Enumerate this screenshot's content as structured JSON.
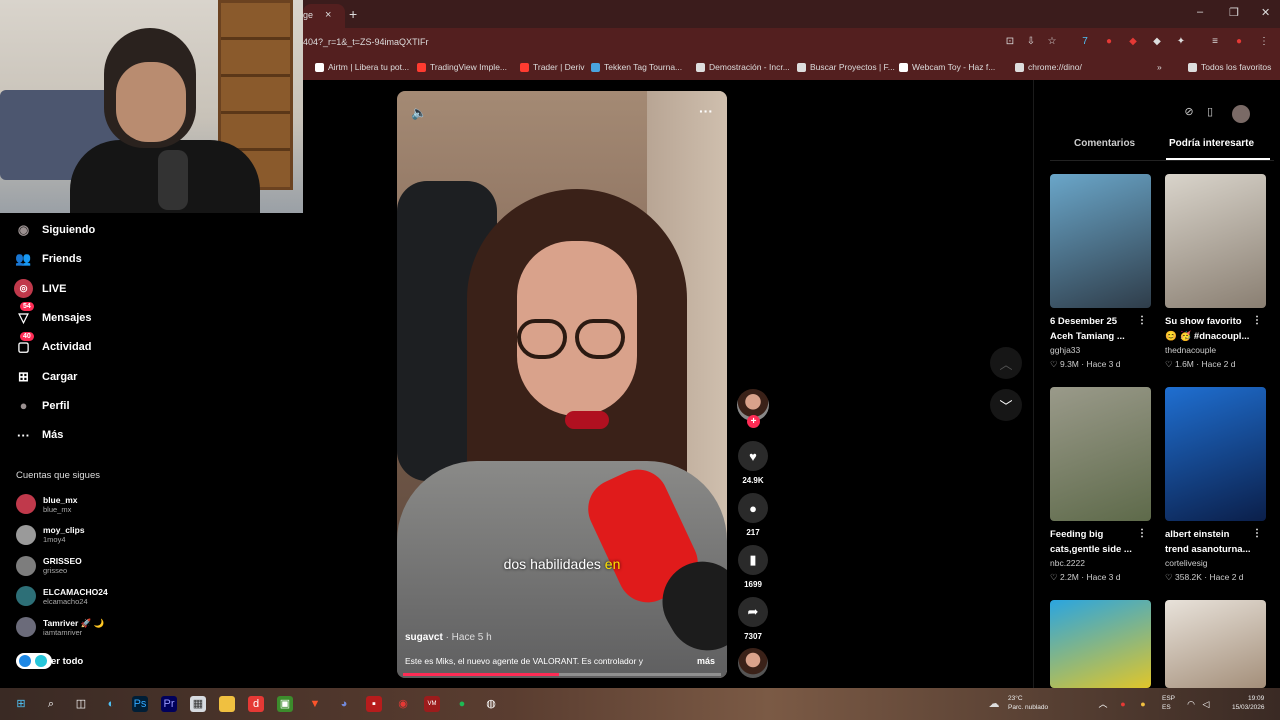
{
  "browser": {
    "tab_close": "×",
    "tab_partial_title": "ge",
    "new_tab": "+",
    "url": "404?_r=1&_t=ZS-94imaQXTIFr",
    "window_controls": {
      "minimize": "–",
      "restore": "❐",
      "close": "✕"
    },
    "bookmarks": [
      {
        "label": "Airtm | Libera tu pot...",
        "color": "#ffffff"
      },
      {
        "label": "TradingView Imple...",
        "color": "#ff3b30"
      },
      {
        "label": "Trader | Deriv",
        "color": "#ff3b30"
      },
      {
        "label": "Tekken Tag Tourna...",
        "color": "#4aa3df"
      },
      {
        "label": "Demostración - Incr...",
        "color": "#dddddd"
      },
      {
        "label": "Buscar Proyectos | F...",
        "color": "#dddddd"
      },
      {
        "label": "Webcam Toy - Haz f...",
        "color": "#ffffff"
      },
      {
        "label": "chrome://dino/",
        "color": "#dddddd"
      }
    ],
    "bookmarks_overflow": "»",
    "all_bookmarks": "Todos los favoritos"
  },
  "sidebar": {
    "nav": [
      {
        "label": "Siguiendo",
        "icon": "following-avatar-icon",
        "glyph": "◉",
        "badge": ""
      },
      {
        "label": "Friends",
        "icon": "friends-icon",
        "glyph": "👥",
        "badge": ""
      },
      {
        "label": "LIVE",
        "icon": "live-icon",
        "glyph": "◎",
        "badge": ""
      },
      {
        "label": "Mensajes",
        "icon": "messages-icon",
        "glyph": "▽",
        "badge": "54"
      },
      {
        "label": "Actividad",
        "icon": "activity-icon",
        "glyph": "▢",
        "badge": "40"
      },
      {
        "label": "Cargar",
        "icon": "upload-icon",
        "glyph": "⊞",
        "badge": ""
      },
      {
        "label": "Perfil",
        "icon": "profile-avatar-icon",
        "glyph": "●",
        "badge": ""
      },
      {
        "label": "Más",
        "icon": "more-icon",
        "glyph": "···",
        "badge": ""
      }
    ],
    "following_title": "Cuentas que sigues",
    "following": [
      {
        "name": "blue_mx",
        "handle": "blue_mx",
        "color": "#c0394b"
      },
      {
        "name": "moy_clips",
        "handle": "1moy4",
        "color": "#9a9a9a"
      },
      {
        "name": "GRISSEO",
        "handle": "grisseo",
        "color": "#7d7d7d"
      },
      {
        "name": "ELCAMACHO24",
        "handle": "elcamacho24",
        "color": "#2d6f77"
      },
      {
        "name": "Tamriver 🚀 🌙",
        "handle": "iamtamriver",
        "color": "#6b6b7a"
      }
    ],
    "see_all": "er todo"
  },
  "video": {
    "caption_main": "dos habilidades ",
    "caption_highlight": "en",
    "author": "sugavct",
    "time": " · Hace 5 h",
    "description": "Este es Miks, el nuevo agente de VALORANT. Es controlador y",
    "more": "más",
    "progress": 0.49,
    "more_options": "···"
  },
  "actions": {
    "likes": "24.9K",
    "comments": "217",
    "saves": "1699",
    "shares": "7307",
    "follow_plus": "+"
  },
  "right_panel": {
    "tabs": [
      {
        "label": "Comentarios",
        "active": false
      },
      {
        "label": "Podría interesarte",
        "active": true
      }
    ],
    "cards": [
      {
        "title1": "6 Desember 25",
        "title2": "Aceh Tamiang ...",
        "user": "gghja33",
        "likes": "9.3M",
        "time": "Hace 3 d",
        "c1": "#6aa6c9",
        "c2": "#2f3d4a"
      },
      {
        "title1": "Su show favorito",
        "title2": "😊 🥳 #dnacoupl...",
        "user": "thednacouple",
        "likes": "1.6M",
        "time": "Hace 2 d",
        "c1": "#d9d4cb",
        "c2": "#8a7f72"
      },
      {
        "title1": "Feeding big",
        "title2": "cats,gentle side ...",
        "user": "nbc.2222",
        "likes": "2.2M",
        "time": "Hace 3 d",
        "c1": "#9a9a8a",
        "c2": "#5e6a4a"
      },
      {
        "title1": "albert einstein",
        "title2": "trend asanoturna...",
        "user": "cortelivesig",
        "likes": "358.2K",
        "time": "Hace 2 d",
        "c1": "#1f6fd1",
        "c2": "#0b1f4a"
      },
      {
        "title1": "",
        "title2": "",
        "user": "",
        "likes": "",
        "time": "",
        "c1": "#2aa5e0",
        "c2": "#e0c62a"
      },
      {
        "title1": "",
        "title2": "",
        "user": "",
        "likes": "",
        "time": "",
        "c1": "#e8e2da",
        "c2": "#a48f7a"
      }
    ],
    "card_dots": "⋮"
  },
  "taskbar": {
    "weather_temp": "23°C",
    "weather_desc": "Parc. nublado",
    "lang1": "ESP",
    "lang2": "ES",
    "time": "19:09",
    "date": "15/03/2026"
  },
  "colors": {
    "accent": "#fe2c55",
    "browser_dark": "#3b1c1c",
    "browser": "#531f1f"
  }
}
